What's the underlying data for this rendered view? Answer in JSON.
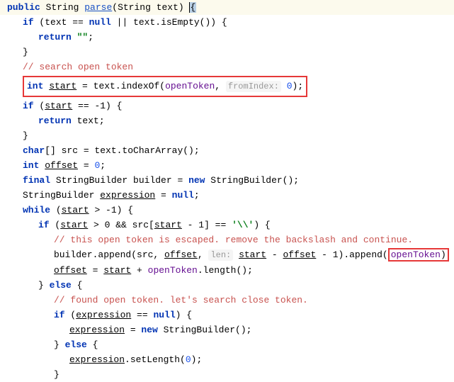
{
  "code": {
    "sig": {
      "public": "public",
      "retType": "String",
      "method": "parse",
      "paramType": "String",
      "paramName": "text",
      "closeParen": ")",
      "brace": "{"
    },
    "line2": {
      "if": "if",
      "expr1": "(text == ",
      "nullkw": "null",
      "expr2": " || text.isEmpty()) {"
    },
    "line3": {
      "ret": "return",
      "empty": "\"\"",
      "semi": ";"
    },
    "line4": "}",
    "line5": "// search open token",
    "line6": {
      "intKw": "int",
      "start": "start",
      "eq": " = text.indexOf(",
      "openToken": "openToken",
      "comma": ", ",
      "hint": "fromIndex:",
      "zero": "0",
      "close": ");"
    },
    "line7": {
      "if": "if",
      "open": " (",
      "start": "start",
      "rest": " == -1) {"
    },
    "line8": {
      "ret": "return",
      "text": " text;"
    },
    "line9": "}",
    "line10": {
      "charKw": "char",
      "brackets": "[] src = text.toCharArray();"
    },
    "line11": {
      "intKw": "int",
      "offset": "offset",
      "eq": " = ",
      "zero": "0",
      "semi": ";"
    },
    "line12": {
      "final": "final",
      "sb": " StringBuilder builder = ",
      "newKw": "new",
      "rest": " StringBuilder();"
    },
    "line13": {
      "sb": "StringBuilder ",
      "expr": "expression",
      "eq": " = ",
      "nullKw": "null",
      "semi": ";"
    },
    "line14": {
      "whileKw": "while",
      "open": " (",
      "start": "start",
      "rest": " > -1) {"
    },
    "line15": {
      "if": "if",
      "open": " (",
      "start1": "start",
      "mid1": " > 0 && src[",
      "start2": "start",
      "mid2": " - 1] == ",
      "charLit": "'\\\\'",
      "close": ") {"
    },
    "line16": "// this open token is escaped. remove the backslash and continue.",
    "line17": {
      "prefix": "builder.append(src, ",
      "offset1": "offset",
      "comma1": ", ",
      "hint": "len:",
      "start": "start",
      "minus": " - ",
      "offset2": "offset",
      "rest": " - 1).append(",
      "openToken": "openToken",
      "close": ")"
    },
    "line18": {
      "offset": "offset",
      "eq": " = ",
      "start": "start",
      "plus": " + ",
      "openToken": "openToken",
      "rest": ".length();"
    },
    "line19": {
      "close": "} ",
      "elseKw": "else",
      "brace": " {"
    },
    "line20": "// found open token. let's search close token.",
    "line21": {
      "if": "if",
      "open": " (",
      "expr": "expression",
      "eq": " == ",
      "nullKw": "null",
      "close": ") {"
    },
    "line22": {
      "expr": "expression",
      "eq": " = ",
      "newKw": "new",
      "rest": " StringBuilder();"
    },
    "line23": {
      "close": "} ",
      "elseKw": "else",
      "brace": " {"
    },
    "line24": {
      "expr": "expression",
      "rest": ".setLength(",
      "zero": "0",
      "close": ");"
    },
    "line25": "}"
  }
}
